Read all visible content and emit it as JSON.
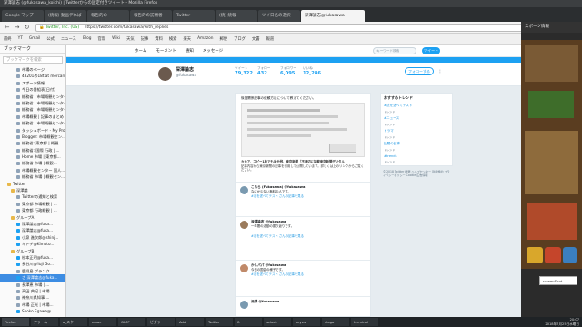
{
  "window": {
    "title": "深澤論志 (@fukasawa_koichi) | Twitterからの固定付きツイート - Mozilla Firefox"
  },
  "tabs": [
    {
      "label": "Google マップ"
    },
    {
      "label": "(続報) 動画デれば"
    },
    {
      "label": "報告的の"
    },
    {
      "label": "報告的の訪問者"
    },
    {
      "label": "Twitter"
    },
    {
      "label": "(続) 続報"
    },
    {
      "label": "ツイ日名の選択"
    },
    {
      "label": "深澤論志@fukasawa"
    }
  ],
  "nav": {
    "url": "https://twitter.com/fukasawa/with_replies",
    "identity": "Twitter, Inc. (US)"
  },
  "bookmarks": [
    "最終",
    "YT",
    "Gmail",
    "公式",
    "ニュース",
    "Blog",
    "官邸",
    "Wiki",
    "天気",
    "記事",
    "資料",
    "検索",
    "楽天",
    "Amazon",
    "郵便",
    "ブログ",
    "文書",
    "報道"
  ],
  "sidebar": {
    "title": "ブックマーク",
    "search_placeholder": "ブックマークを検索",
    "items": [
      "市場のページ",
      "48201の18t at mercari",
      "スポーツ情報",
      "今日の番組表(日付)",
      "総務省 | 市場概観センター",
      "総務省 | 市場概観センター",
      "総務省 | 市場概観センター",
      "市場概観 | 記事のまとめ",
      "総務省 | 市場概観センター",
      "ダッシュボード - My Pro...",
      "Blogger: 市場概観セン...",
      "総務省: 東京都 | 概観...",
      "総務省: 国際 行政 | ...",
      "Home 市場 | 東京都...",
      "総務省 市場 | 概観...",
      "市場概観センター 国人...",
      "総務省 市場 | 概観セン...",
      "Twitter",
      "深澤論",
      "Twitterの通知と検索",
      "東京都 市場概観 | ...",
      "東京都 行政概観 | ...",
      "グループA",
      "深澤論志@fuka...",
      "深澤論志@fuka...",
      "小泉 進次郎@shinj...",
      "ギトチ@Kimoto...",
      "グループB",
      "松本正明@fuka...",
      "長谷川@Yuji Go...",
      "鹿児島 ブランク...",
      "さ 深澤論志@fuka...",
      "長澤恵 市場 | ...",
      "高田 典紀 | 市場...",
      "神奈川県知事 ...",
      "市場 正光 | 市場...",
      "Shoko Egawa@..."
    ]
  },
  "twitter": {
    "nav": [
      "ホーム",
      "モーメント",
      "通知",
      "メッセージ"
    ],
    "search_placeholder": "キーワード検索",
    "tweet_button": "ツイート",
    "profile": {
      "name": "深澤論志",
      "handle": "@fukasawa"
    },
    "stats": [
      {
        "label": "ツイート",
        "value": "79,322"
      },
      {
        "label": "フォロー",
        "value": "432"
      },
      {
        "label": "フォロワー",
        "value": "6,095"
      },
      {
        "label": "いいね",
        "value": "12,286"
      }
    ],
    "follow_button": "フォローする",
    "pinned_text": "後援関係記事の依頼方法について教えてください。",
    "article_caption": "カカア、コピー1枚でも半分残、東京新聞「不適切に記載東京新聞デジタル",
    "article_body": "記事内容から東京新聞の記事を引用して公開しています。詳しくは上のリンクからご覧ください。",
    "tweets": [
      {
        "name": "こちら (Fukasawa) @fukasawa",
        "body": "なにか少ない無料の人です。",
        "link": "#法を述べてテスト さんの記事を見る"
      },
      {
        "name": "深澤論志 @fukasawa",
        "body": "一年間の活動の振り返りです。",
        "link": "#法を述べてテスト さんの記事を見る"
      },
      {
        "name": "かしパパ @fukasawa",
        "body": "今日の国会の様子です。",
        "link": "#法を述べてテスト さんの記事を見る"
      },
      {
        "name": "深澤 @fukasawa",
        "body": "",
        "link": ""
      }
    ],
    "right": {
      "title": "おすすめトレンド",
      "trends": [
        {
          "tag": "#法を述べてテスト",
          "sub": "トレンド"
        },
        {
          "tag": "#ニュース",
          "sub": "トレンド"
        },
        {
          "tag": "ドラマ",
          "sub": "トレンド"
        },
        {
          "tag": "話題の記事",
          "sub": "トレンド"
        },
        {
          "tag": "#trends",
          "sub": "トレンド"
        }
      ],
      "footer": "© 2018 Twitter 概要 ヘルプセンター 利用規約 プライバシーポリシー Cookie 広告情報"
    }
  },
  "game": {
    "title": "スポーツ情報",
    "screenshot_label": "screenShot"
  },
  "taskbar": {
    "items": [
      "Firefox",
      "アラーム",
      "a_スク",
      "emac",
      "GIMP",
      "ピグラ",
      "Add",
      "Twitter",
      "ft",
      "sclock",
      "xeyes",
      "xlogo",
      "terminal"
    ],
    "time": "20:07",
    "date": "2018年7月25日水曜日"
  }
}
